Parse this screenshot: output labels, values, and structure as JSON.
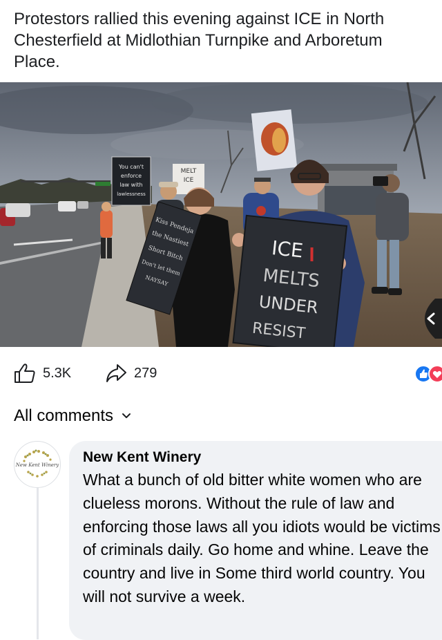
{
  "post": {
    "caption": "Protestors rallied this evening against ICE in North Chesterfield at Midlothian Turnpike and Arboretum Place."
  },
  "photo": {
    "signs": {
      "left_sign": [
        "You can't",
        "enforce",
        "law with",
        "lawlessness"
      ],
      "melt_sign": [
        "MELT",
        "ICE"
      ],
      "black_sign_lines": [
        "Kiss Pendeja",
        "the Nastiest",
        "Short Bitch",
        "Don't let them",
        "NAYSAY"
      ],
      "main_sign": [
        "ICE",
        "MELTS",
        "UNDER",
        "RESIST"
      ]
    }
  },
  "reactions": {
    "like_count": "5.3K",
    "share_count": "279"
  },
  "comments_header": {
    "label": "All comments"
  },
  "comment": {
    "author": "New Kent Winery",
    "avatar_text": "New Kent Winery",
    "text": "What a bunch of old bitter white women who are clueless morons.  Without the rule of law and enforcing those laws all you idiots would be victims of criminals daily.  Go home and whine.  Leave the country and live in Some third world country.  You will not survive a week."
  },
  "colors": {
    "like_blue": "#1877f2",
    "love_red": "#f33e58",
    "bubble_bg": "#f0f2f5",
    "text": "#050505"
  }
}
